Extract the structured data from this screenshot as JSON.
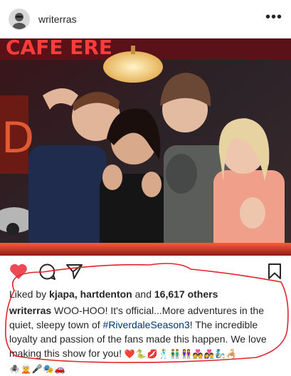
{
  "post": {
    "username": "writerras",
    "more_label": "•••"
  },
  "photo": {
    "sign_text": "CAFE  ERE",
    "neon_side": "D",
    "alt_label": "Riverdale cast in diner"
  },
  "likes": {
    "prefix": "Liked by ",
    "users": "kjapa, hartdenton",
    "middle": " and ",
    "count": "16,617 others"
  },
  "caption": {
    "user": "writerras",
    "text_before": " WOO-HOO! It's official...More adventures in the quiet, sleepy town of ",
    "hashtag": "#RiverdaleSeason3",
    "text_after": "! The incredible loyalty and passion of the fans made this happen. We love making this show for you! ",
    "emojis_line1": "❤️🐍💋🕺👬👭💑👩‍❤️‍👨🧞🦂",
    "emojis_line2": "🕷️🧝🎤🎭🚗"
  },
  "colors": {
    "heart": "#ed4956",
    "hashtag": "#003569",
    "annotation": "#e0242d"
  },
  "icons": [
    "heart-icon",
    "comment-icon",
    "share-icon",
    "bookmark-icon",
    "more-icon"
  ]
}
